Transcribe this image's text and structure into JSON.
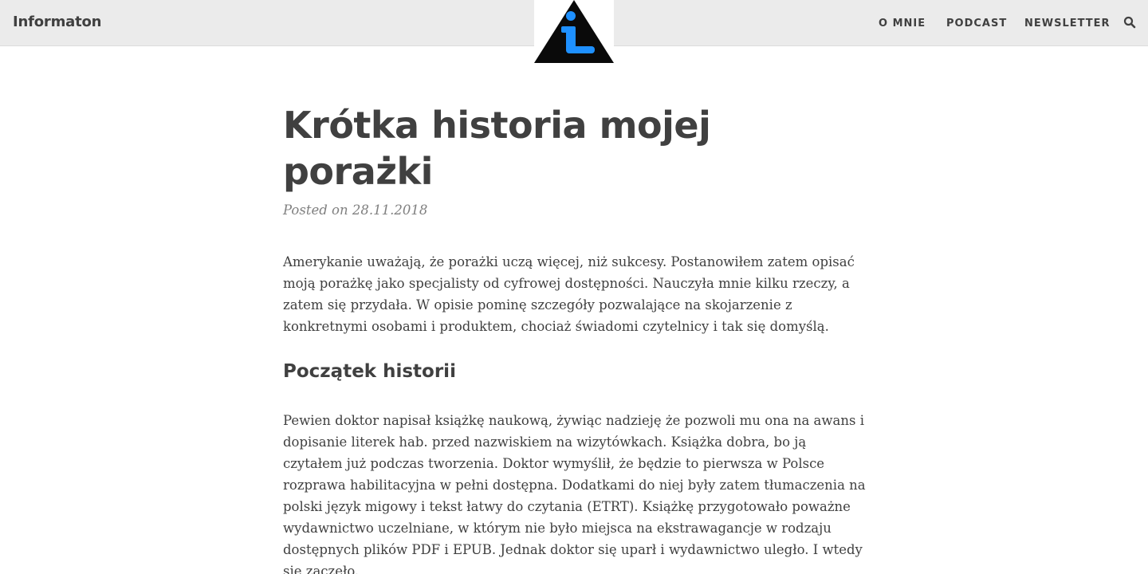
{
  "site": {
    "brand": "Informaton",
    "logo_icon": "info-triangle-logo-icon",
    "accent": "#1e90ff"
  },
  "nav": {
    "items": [
      {
        "label": "O MNIE"
      },
      {
        "label": "PODCAST"
      },
      {
        "label": "NEWSLETTER"
      }
    ],
    "search_icon": "search-icon"
  },
  "article": {
    "title": "Krótka historia mojej porażki",
    "posted": "Posted on 28.11.2018",
    "intro": "Amerykanie uważają, że porażki uczą więcej, niż sukcesy. Postanowiłem zatem opisać moją porażkę jako specjalisty od cyfrowej dostępności. Nauczyła mnie kilku rzeczy, a zatem się przydała. W opisie pominę szczegóły pozwalające na skojarzenie z konkretnymi osobami i produktem, chociaż świadomi czytelnicy i tak się domyślą.",
    "section_heading": "Początek historii",
    "section_text": "Pewien doktor napisał książkę naukową, żywiąc nadzieję że pozwoli mu ona na awans i dopisanie literek hab. przed nazwiskiem na wizytówkach. Książka dobra, bo ją czytałem już podczas tworzenia. Doktor wymyślił, że będzie to pierwsza w Polsce rozprawa habilitacyjna w pełni dostępna. Dodatkami do niej były zatem tłumaczenia na polski język migowy i tekst łatwy do czytania (ETRT). Książkę przygotowało poważne wydawnictwo uczelniane, w którym nie było miejsca na ekstrawagancje w rodzaju dostępnych plików PDF i EPUB. Jednak doktor się uparł i wydawnictwo uległo. I wtedy się zaczęło."
  }
}
